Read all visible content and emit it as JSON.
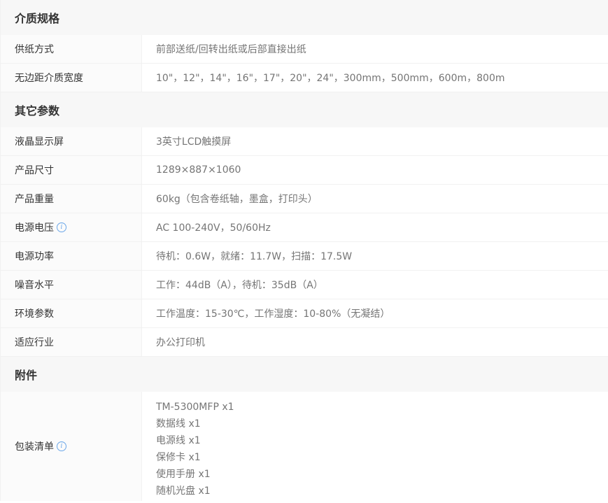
{
  "sections": [
    {
      "title": "介质规格",
      "rows": [
        {
          "label": "供纸方式",
          "value": "前部送纸/回转出纸或后部直接出纸"
        },
        {
          "label": "无边距介质宽度",
          "value": "10\"，12\"，14\"，16\"，17\"，20\"，24\"，300mm，500mm，600m，800m"
        }
      ]
    },
    {
      "title": "其它参数",
      "rows": [
        {
          "label": "液晶显示屏",
          "value": "3英寸LCD触摸屏"
        },
        {
          "label": "产品尺寸",
          "value": "1289×887×1060"
        },
        {
          "label": "产品重量",
          "value": "60kg（包含卷纸轴，墨盒，打印头）"
        },
        {
          "label": "电源电压",
          "value": "AC 100-240V，50/60Hz"
        },
        {
          "label": "电源功率",
          "value": "待机：0.6W，就绪：11.7W，扫描：17.5W"
        },
        {
          "label": "噪音水平",
          "value": "工作：44dB（A），待机：35dB（A）"
        },
        {
          "label": "环境参数",
          "value": "工作温度：15-30℃，工作湿度：10-80%（无凝结）"
        },
        {
          "label": "适应行业",
          "value": "办公打印机"
        }
      ]
    },
    {
      "title": "附件",
      "package_label": "包装清单",
      "package_items": [
        "TM-5300MFP x1",
        "数据线 x1",
        "电源线 x1",
        "保修卡 x1",
        "使用手册 x1",
        "随机光盘 x1"
      ]
    }
  ],
  "icons": {
    "info": "info-icon",
    "info_glyph": "i",
    "info_color": "#6aa6e8"
  }
}
